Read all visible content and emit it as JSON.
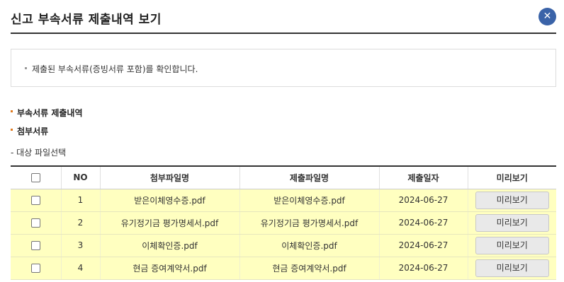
{
  "page": {
    "title": "신고 부속서류 제출내역 보기",
    "close_icon": "close-icon",
    "close_symbol": "✕"
  },
  "notice": {
    "text": "제출된 부속서류(증빙서류 포함)를 확인합니다."
  },
  "sections": {
    "submission_history": "부속서류 제출내역",
    "attachments": "첨부서류",
    "file_select": "- 대상 파일선택"
  },
  "table": {
    "headers": [
      "",
      "NO",
      "첨부파일명",
      "제출파일명",
      "제출일자",
      "미리보기"
    ],
    "rows": [
      {
        "no": "1",
        "attach_name": "받은이체영수증.pdf",
        "submit_name": "받은이체영수증.pdf",
        "date": "2024-06-27",
        "preview": "미리보기"
      },
      {
        "no": "2",
        "attach_name": "유기정기금 평가명세서.pdf",
        "submit_name": "유기정기금 평가명세서.pdf",
        "date": "2024-06-27",
        "preview": "미리보기"
      },
      {
        "no": "3",
        "attach_name": "이체확인증.pdf",
        "submit_name": "이체확인증.pdf",
        "date": "2024-06-27",
        "preview": "미리보기"
      },
      {
        "no": "4",
        "attach_name": "현금 증여계약서.pdf",
        "submit_name": "현금 증여계약서.pdf",
        "date": "2024-06-27",
        "preview": "미리보기"
      }
    ]
  },
  "colors": {
    "row_highlight": "#ffffc0",
    "close_button": "#3a63a8",
    "section_bullet": "#e07a1f"
  }
}
